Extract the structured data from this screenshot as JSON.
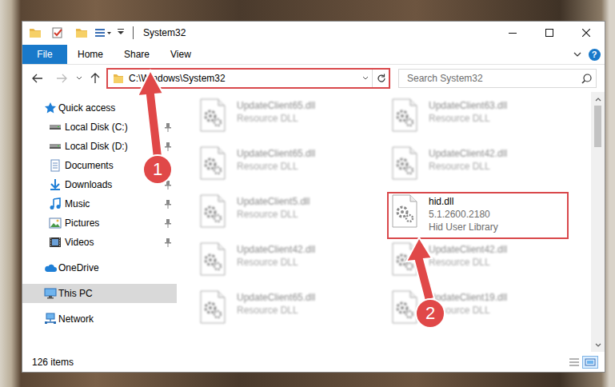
{
  "window": {
    "title": "System32"
  },
  "ribbon": {
    "file": "File",
    "tabs": [
      "Home",
      "Share",
      "View"
    ],
    "help": "?"
  },
  "address": {
    "path": "C:\\Windows\\System32",
    "annotated": true
  },
  "search": {
    "placeholder": "Search System32"
  },
  "nav": [
    {
      "label": "Quick access",
      "kind": "quick-access",
      "pinned": false,
      "selected": false
    },
    {
      "label": "Local Disk (C:)",
      "kind": "drive",
      "pinned": true,
      "selected": false
    },
    {
      "label": "Local Disk (D:)",
      "kind": "drive",
      "pinned": true,
      "selected": false
    },
    {
      "label": "Documents",
      "kind": "documents",
      "pinned": true,
      "selected": false
    },
    {
      "label": "Downloads",
      "kind": "downloads",
      "pinned": true,
      "selected": false
    },
    {
      "label": "Music",
      "kind": "music",
      "pinned": true,
      "selected": false
    },
    {
      "label": "Pictures",
      "kind": "pictures",
      "pinned": true,
      "selected": false
    },
    {
      "label": "Videos",
      "kind": "videos",
      "pinned": true,
      "selected": false
    },
    {
      "label": "OneDrive",
      "kind": "onedrive",
      "pinned": false,
      "selected": false
    },
    {
      "label": "This PC",
      "kind": "pc",
      "pinned": false,
      "selected": true
    },
    {
      "label": "Network",
      "kind": "network",
      "pinned": false,
      "selected": false
    }
  ],
  "files": [
    {
      "name": "UpdateClient65.dll",
      "detail": [
        "Resource DLL"
      ],
      "blurred": true,
      "annotated": false
    },
    {
      "name": "UpdateClient63.dll",
      "detail": [
        "Resource DLL"
      ],
      "blurred": true,
      "annotated": false
    },
    {
      "name": "UpdateClient65.dll",
      "detail": [
        "Resource DLL"
      ],
      "blurred": true,
      "annotated": false
    },
    {
      "name": "UpdateClient42.dll",
      "detail": [
        "Resource DLL"
      ],
      "blurred": true,
      "annotated": false
    },
    {
      "name": "UpdateClient5.dll",
      "detail": [
        "Resource DLL"
      ],
      "blurred": true,
      "annotated": false
    },
    {
      "name": "hid.dll",
      "detail": [
        "5.1.2600.2180",
        "Hid User Library"
      ],
      "blurred": false,
      "annotated": true
    },
    {
      "name": "UpdateClient42.dll",
      "detail": [
        "Resource DLL"
      ],
      "blurred": true,
      "annotated": false
    },
    {
      "name": "UpdateClient42.dll",
      "detail": [
        "Resource DLL"
      ],
      "blurred": true,
      "annotated": false
    },
    {
      "name": "UpdateClient65.dll",
      "detail": [
        "Resource DLL"
      ],
      "blurred": true,
      "annotated": false
    },
    {
      "name": "UpdateClient19.dll",
      "detail": [
        "Resource DLL"
      ],
      "blurred": true,
      "annotated": false
    }
  ],
  "status_bar": {
    "count": "126 items"
  },
  "annotations": [
    {
      "number": "1"
    },
    {
      "number": "2"
    }
  ]
}
